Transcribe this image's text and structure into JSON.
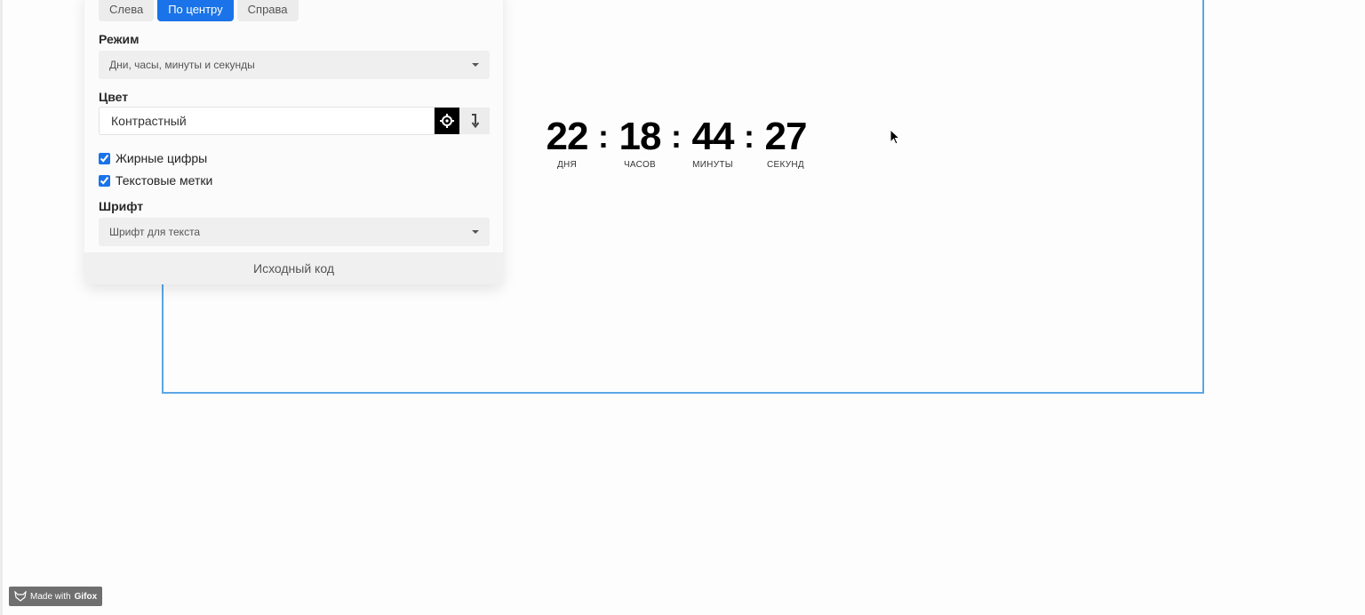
{
  "panel": {
    "align_buttons": [
      {
        "label": "Слева",
        "active": false
      },
      {
        "label": "По центру",
        "active": true
      },
      {
        "label": "Справа",
        "active": false
      }
    ],
    "mode_label": "Режим",
    "mode_value": "Дни, часы, минуты и секунды",
    "color_label": "Цвет",
    "color_value": "Контрастный",
    "bold_digits_label": "Жирные цифры",
    "bold_digits_checked": true,
    "text_labels_label": "Текстовые метки",
    "text_labels_checked": true,
    "font_label": "Шрифт",
    "font_value": "Шрифт для текста",
    "source_code_label": "Исходный код"
  },
  "timer": {
    "days": "22",
    "hours": "18",
    "minutes": "44",
    "seconds": "27",
    "separator": ":",
    "days_label": "ДНЯ",
    "hours_label": "ЧАСОВ",
    "minutes_label": "МИНУТЫ",
    "seconds_label": "СЕКУНД"
  },
  "badge": {
    "prefix": "Made with",
    "brand": "Gifox"
  },
  "colors": {
    "accent": "#1a73e8",
    "frame": "#5aa6e6"
  }
}
